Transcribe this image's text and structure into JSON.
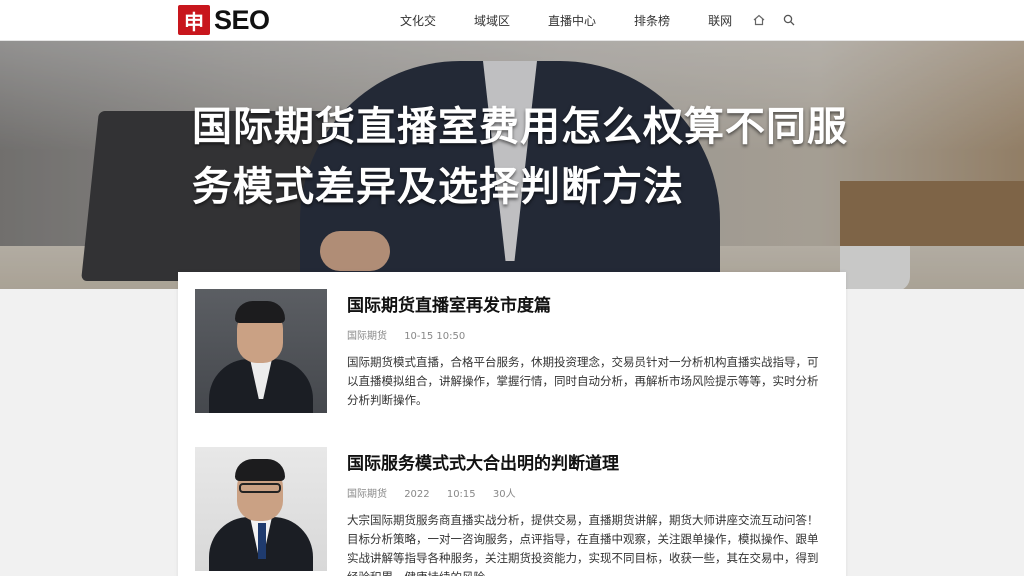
{
  "header": {
    "logo_mark": "申",
    "logo_text": "SEO",
    "nav": [
      "文化交",
      "域域区",
      "直播中心",
      "排条榜",
      "联网"
    ],
    "icons": [
      "home-icon",
      "search-icon"
    ]
  },
  "hero": {
    "title": "国际期货直播室费用怎么权算不同服务模式差异及选择判断方法"
  },
  "articles": [
    {
      "title": "国际期货直播室再发市度篇",
      "meta": [
        "国际期货",
        "10-15 10:50"
      ],
      "excerpt": "国际期货模式直播，合格平台服务，休期投资理念，交易员针对一分析机构直播实战指导，可以直播模拟组合，讲解操作，掌握行情，同时自动分析，再解析市场风险提示等等，实时分析分析判断操作。"
    },
    {
      "title": "国际服务模式式大合出明的判断道理",
      "meta": [
        "国际期货",
        "2022",
        "10:15",
        "30人"
      ],
      "excerpt": "大宗国际期货服务商直播实战分析，提供交易，直播期货讲解，期货大师讲座交流互动问答！目标分析策略，一对一咨询服务，点评指导，在直播中观察，关注跟单操作，模拟操作、跟单实战讲解等指导各种服务，关注期货投资能力，实现不同目标，收获一些，其在交易中，得到经验积累，健康持续的风险。"
    }
  ],
  "colors": {
    "brand_red": "#c8161d",
    "header_bg": "#ffffff",
    "page_bg": "#f1f1f1"
  }
}
